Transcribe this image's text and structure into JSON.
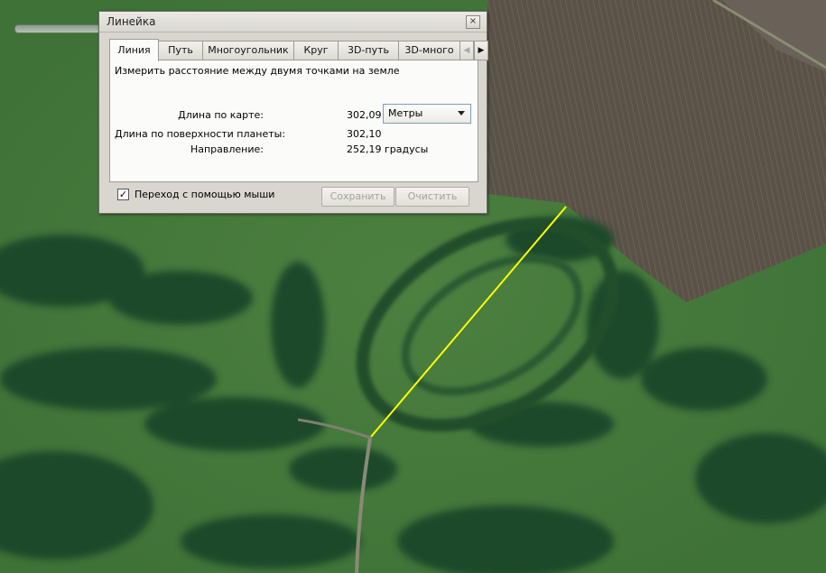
{
  "window": {
    "title": "Линейка",
    "close_icon": "close-icon"
  },
  "tabs": [
    {
      "label": "Линия",
      "active": true
    },
    {
      "label": "Путь",
      "active": false
    },
    {
      "label": "Многоугольник",
      "active": false
    },
    {
      "label": "Круг",
      "active": false
    },
    {
      "label": "3D-путь",
      "active": false
    },
    {
      "label": "3D-много",
      "active": false
    }
  ],
  "tab_scroll": {
    "left_icon": "chevron-left-icon",
    "right_icon": "chevron-right-icon"
  },
  "panel": {
    "description": "Измерить расстояние между двумя точками на земле",
    "map_length_label": "Длина по карте:",
    "map_length_value": "302,09",
    "units_selected": "Метры",
    "surface_length_label": "Длина по поверхности планеты:",
    "surface_length_value": "302,10",
    "heading_label": "Направление:",
    "heading_value": "252,19 градусы"
  },
  "footer": {
    "mouse_nav_label": "Переход с помощью мыши",
    "mouse_nav_checked": true,
    "save_label": "Сохранить",
    "clear_label": "Очистить"
  },
  "map": {
    "measure_line_color": "#ffff00"
  }
}
